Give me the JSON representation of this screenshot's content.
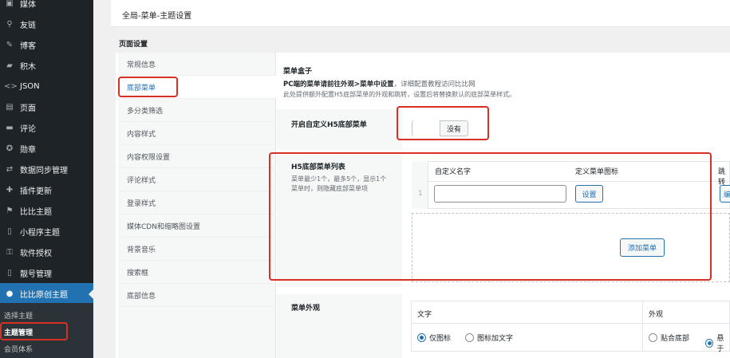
{
  "sidebar": {
    "items": [
      {
        "icon": "media-icon",
        "glyph": "▣",
        "label": "媒体"
      },
      {
        "icon": "link-icon",
        "glyph": "⚲",
        "label": "友链"
      },
      {
        "icon": "blog-icon",
        "glyph": "✎",
        "label": "博客"
      },
      {
        "icon": "points-icon",
        "glyph": "▰",
        "label": "积木"
      },
      {
        "icon": "code-icon",
        "glyph": "<>",
        "label": "JSON"
      },
      {
        "icon": "page-icon",
        "glyph": "▤",
        "label": "页面"
      },
      {
        "icon": "comment-icon",
        "glyph": "▬",
        "label": "评论"
      },
      {
        "icon": "medal-icon",
        "glyph": "✪",
        "label": "勋章"
      },
      {
        "icon": "sync-icon",
        "glyph": "⇄",
        "label": "数据同步管理"
      },
      {
        "icon": "plugin-icon",
        "glyph": "✚",
        "label": "插件更新"
      },
      {
        "icon": "pin-icon",
        "glyph": "⚑",
        "label": "比比主题"
      },
      {
        "icon": "phone-icon",
        "glyph": "▯",
        "label": "小程序主题"
      },
      {
        "icon": "lock-icon",
        "glyph": "⚿",
        "label": "软件授权"
      },
      {
        "icon": "phone-icon",
        "glyph": "▯",
        "label": "靓号管理"
      },
      {
        "icon": "theme-logo-icon",
        "glyph": "●",
        "label": "比比原创主题"
      }
    ],
    "submenu": [
      "选择主题",
      "主题管理",
      "会员体系"
    ]
  },
  "header": {
    "title": "全局-菜单-主题设置"
  },
  "page_settings_label": "页面设置",
  "tabs": [
    "常规信息",
    "底部菜单",
    "多分类筛选",
    "内容样式",
    "内容权限设置",
    "评论样式",
    "登录样式",
    "媒体CDN和缩略图设置",
    "背景音乐",
    "搜索框",
    "底部信息"
  ],
  "panel": {
    "menu_box_title": "菜单盒子",
    "menu_box_desc_bold": "PC端的菜单请前往外观>菜单中设置",
    "menu_box_desc_rest": "，详细配置教程访问比比网",
    "menu_box_desc2": "此处提供额外配置H5底部菜单的外观和跳转，设置后将替换默认的底部菜单样式。",
    "enable_label": "开启自定义H5底部菜单",
    "toggle_label": "没有",
    "list_title": "H5底部菜单列表",
    "list_desc": "菜单最少1个，最多5个，显示1个菜单时，则隐藏底部菜单项",
    "col_name": "自定义名字",
    "col_icon": "定义菜单图标",
    "col_jump": "跳转",
    "row_index": "1",
    "set_button": "设置",
    "edit_button": "编",
    "add_menu_button": "添加菜单",
    "appearance_label": "菜单外观",
    "text_header": "文字",
    "look_header": "外观",
    "radio_icon_only": "仅图标",
    "radio_icon_text": "图标加文字",
    "radio_stick_bottom": "贴合底部",
    "radio_float": "悬于"
  },
  "colors": {
    "highlight": "#d93025",
    "accent": "#2271b1",
    "sidebar_bg": "#1d2327"
  }
}
